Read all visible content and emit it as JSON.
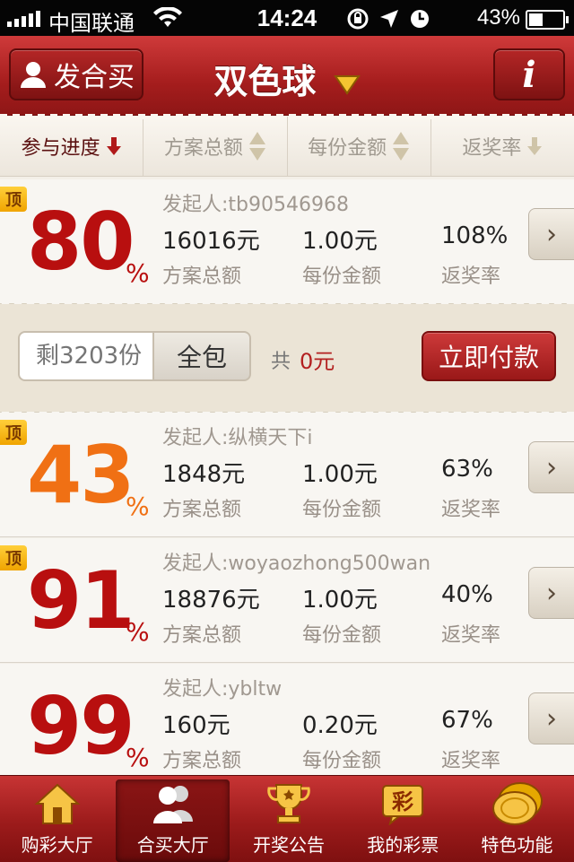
{
  "status_bar": {
    "carrier": "中国联通",
    "time": "14:24",
    "battery": "43%"
  },
  "nav": {
    "left_button": "发合买",
    "title": "双色球",
    "right_button": "i"
  },
  "sort_bar": {
    "columns": [
      {
        "label": "参与进度",
        "active": true
      },
      {
        "label": "方案总额",
        "active": false
      },
      {
        "label": "每份金额",
        "active": false
      },
      {
        "label": "返奖率",
        "active": false
      }
    ]
  },
  "labels": {
    "initiator_prefix": "发起人:",
    "total": "方案总额",
    "per_share": "每份金额",
    "return_rate": "返奖率",
    "top_badge": "顶",
    "percent_sign": "%"
  },
  "plans": [
    {
      "initiator": "发起人:tb90546968",
      "progress": "80",
      "total": "16016元",
      "per_share": "1.00元",
      "return_rate": "108%",
      "pinned": true,
      "color": "#b80f0f"
    },
    {
      "initiator": "发起人:纵横天下i",
      "progress": "43",
      "total": "1848元",
      "per_share": "1.00元",
      "return_rate": "63%",
      "pinned": true,
      "color": "#f07014"
    },
    {
      "initiator": "发起人:woyaozhong500wan",
      "progress": "91",
      "total": "18876元",
      "per_share": "1.00元",
      "return_rate": "40%",
      "pinned": true,
      "color": "#b80f0f"
    },
    {
      "initiator": "发起人:ybltw",
      "progress": "99",
      "total": "160元",
      "per_share": "0.20元",
      "return_rate": "67%",
      "pinned": false,
      "color": "#b80f0f"
    }
  ],
  "action_panel": {
    "shares_placeholder": "剩3203份",
    "buy_all": "全包",
    "total_prefix": "共",
    "total_amount": "0元",
    "pay_button": "立即付款"
  },
  "tabs": [
    {
      "label": "购彩大厅",
      "icon": "house-icon",
      "active": false
    },
    {
      "label": "合买大厅",
      "icon": "group-users-icon",
      "active": true
    },
    {
      "label": "开奖公告",
      "icon": "trophy-icon",
      "active": false
    },
    {
      "label": "我的彩票",
      "icon": "lottery-ticket-icon",
      "active": false
    },
    {
      "label": "特色功能",
      "icon": "gold-coin-icon",
      "active": false
    }
  ],
  "colors": {
    "brand_red": "#a51d1d",
    "progress_red": "#b80f0f",
    "progress_orange": "#f07014",
    "badge_gold": "#f0a400"
  }
}
